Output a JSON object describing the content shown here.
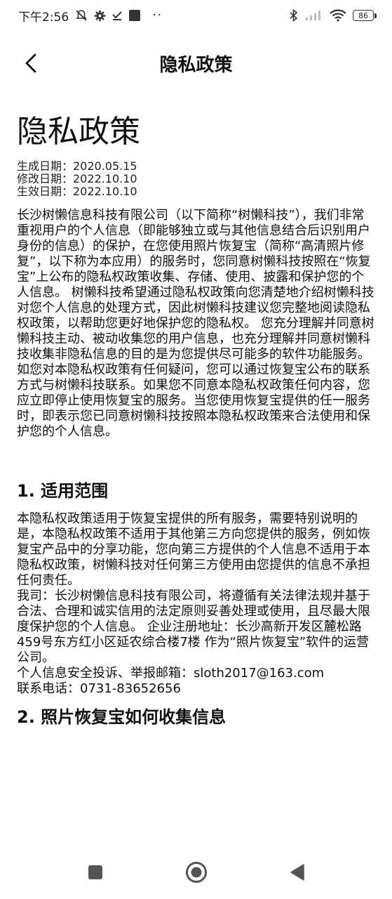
{
  "status_bar": {
    "time": "下午2:56",
    "dots": "··",
    "battery": "86"
  },
  "app_bar": {
    "title": "隐私政策"
  },
  "document": {
    "title": "隐私政策",
    "dates": [
      "生成日期：2020.05.15",
      "修改日期：2022.10.10",
      "生效日期：2022.10.10"
    ],
    "intro": "长沙树懒信息科技有限公司（以下简称“树懒科技”），我们非常重视用户的个人信息（即能够独立或与其他信息结合后识别用户身份的信息）的保护，在您使用照片恢复宝（简称“高清照片修复”，以下称为本应用）的服务时，您同意树懒科技按照在“恢复宝”上公布的隐私权政策收集、存储、使用、披露和保护您的个人信息。 树懒科技希望通过隐私权政策向您清楚地介绍树懒科技对您个人信息的处理方式，因此树懒科技建议您完整地阅读隐私权政策，以帮助您更好地保护您的隐私权。 您充分理解并同意树懒科技主动、被动收集您的用户信息，也充分理解并同意树懒科技收集非隐私信息的目的是为您提供尽可能多的软件功能服务。 如您对本隐私权政策有任何疑问，您可以通过恢复宝公布的联系方式与树懒科技联系。如果您不同意本隐私权政策任何内容，您应立即停止使用恢复宝的服务。当您使用恢复宝提供的任一服务时，即表示您已同意树懒科技按照本隐私权政策来合法使用和保护您的个人信息。",
    "section1": {
      "heading": "1. 适用范围",
      "paragraph1": "本隐私权政策适用于恢复宝提供的所有服务，需要特别说明的是，本隐私权政策不适用于其他第三方向您提供的服务，例如恢复宝产品中的分享功能，您向第三方提供的个人信息不适用于本隐私权政策，树懒科技对任何第三方使用由您提供的信息不承担任何责任。",
      "paragraph2": "我司：长沙树懒信息科技有限公司，将遵循有关法律法规并基于合法、合理和诚实信用的法定原则妥善处理或使用，且尽最大限度保护您的个人信息。 企业注册地址：长沙高新开发区麓松路459号东方红小区延农综合楼7楼 作为“照片恢复宝”软件的运营公司。",
      "email_line": "个人信息安全投诉、举报邮箱：sloth2017@163.com",
      "phone_line": "联系电话：0731-83652656"
    },
    "section2": {
      "heading": "2. 照片恢复宝如何收集信息"
    }
  },
  "icons": {
    "mute": "mute-icon",
    "settings": "gear-icon",
    "download": "download-done-icon",
    "square": "square-icon",
    "bluetooth": "bluetooth-icon",
    "signal": "signal-icon",
    "wifi": "wifi-icon",
    "battery": "battery-icon",
    "back": "chevron-left-icon",
    "nav_recent": "square-recents-icon",
    "nav_home": "circle-home-icon",
    "nav_back": "triangle-back-icon"
  }
}
